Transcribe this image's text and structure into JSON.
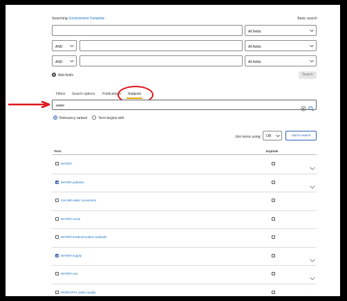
{
  "header": {
    "searching_label": "Searching:",
    "database": "Environment Complete",
    "basic_search": "Basic search"
  },
  "search_rows": [
    {
      "operator": "",
      "value": "",
      "field": "All fields"
    },
    {
      "operator": "AND",
      "value": "",
      "field": "All fields"
    },
    {
      "operator": "AND",
      "value": "",
      "field": "All fields"
    }
  ],
  "add_fields_label": "Add fields",
  "search_button": "Search",
  "tabs": [
    "Filters",
    "Search options",
    "Publications",
    "Subjects"
  ],
  "active_tab": "Subjects",
  "subject_search": {
    "value": "water"
  },
  "radio_options": [
    {
      "label": "Relevancy ranked",
      "selected": true
    },
    {
      "label": "Term begins with",
      "selected": false
    }
  ],
  "join": {
    "label": "Join terms using:",
    "value": "OR",
    "add_button": "Add to search"
  },
  "table": {
    "col_term": "Term",
    "col_explode": "Explode",
    "rows": [
      {
        "term": "WATER",
        "checked": false,
        "expand": true
      },
      {
        "term": "WATER pollution",
        "checked": true,
        "expand": true
      },
      {
        "term": "SALINE water conversion",
        "checked": false,
        "expand": false
      },
      {
        "term": "WATER reuse",
        "checked": false,
        "expand": false
      },
      {
        "term": "WATER treatment plant residuals",
        "checked": false,
        "expand": false
      },
      {
        "term": "WATER supply",
        "checked": true,
        "expand": true
      },
      {
        "term": "WATER use",
        "checked": false,
        "expand": true
      },
      {
        "term": "MUNICIPAL water supply",
        "checked": false,
        "expand": true
      }
    ]
  },
  "colors": {
    "link": "#1a6fc4",
    "accent": "#2d5fb5",
    "annotation": "#e0141a"
  }
}
